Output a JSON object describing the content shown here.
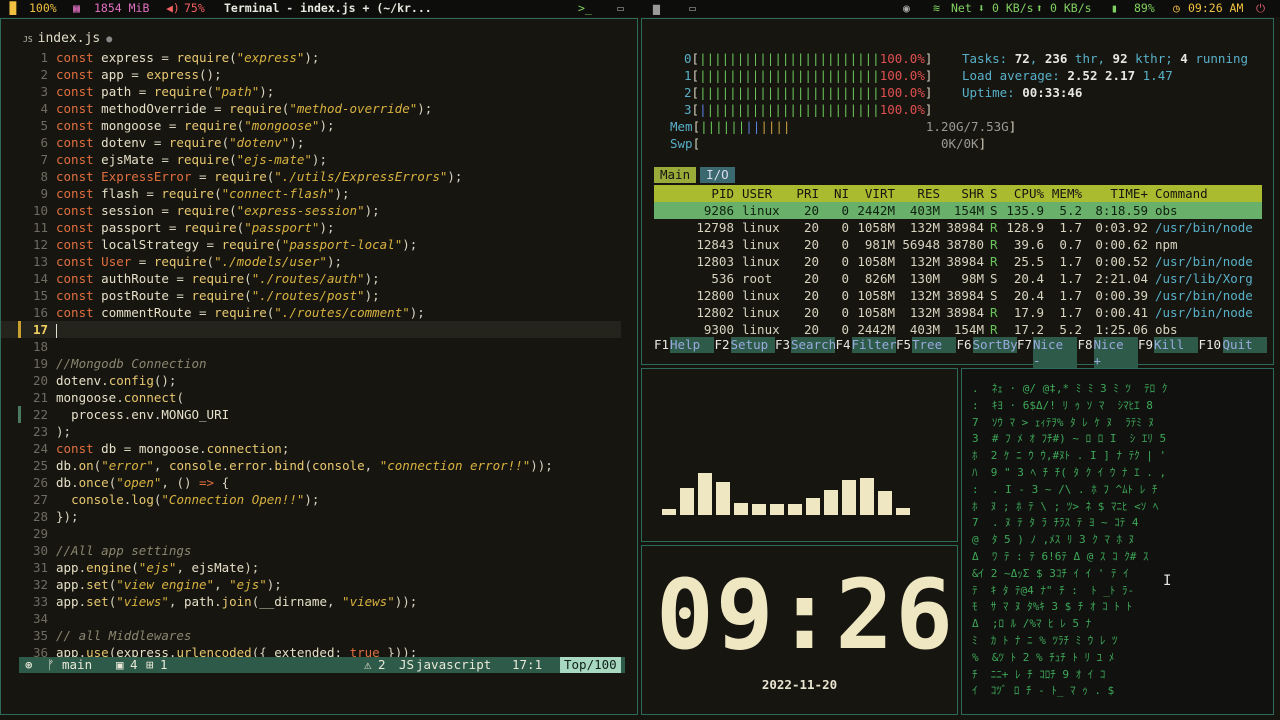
{
  "topbar": {
    "cpu_icon": "cpu-chart-icon",
    "cpu": "100%",
    "mem_icon": "memory-icon",
    "mem": "1854 MiB",
    "vol_icon": "volume-icon",
    "vol": "75%",
    "title": "Terminal - index.js + (~/kr...",
    "ws_icons": [
      "terminal-icon",
      "monitor-icon",
      "folder-icon",
      "display-icon"
    ],
    "net_label": "Net",
    "net_down": "0 KB/s",
    "net_up": "0 KB/s",
    "battery": "89%",
    "time": "09:26 AM"
  },
  "editor": {
    "filename": "index.js",
    "status": {
      "mode_icon": "vim-icon",
      "branch": "main",
      "changes": "4",
      "added": "1",
      "warnings": "2",
      "lang": "javascript",
      "pos": "17:1",
      "pct": "Top/100"
    }
  },
  "htop": {
    "cpus": [
      {
        "id": "0",
        "pct": "100.0%"
      },
      {
        "id": "1",
        "pct": "100.0%"
      },
      {
        "id": "2",
        "pct": "100.0%"
      },
      {
        "id": "3",
        "pct": "100.0%"
      }
    ],
    "mem_label": "Mem",
    "mem_val": "1.20G/7.53G",
    "swp_label": "Swp",
    "swp_val": "0K/0K",
    "tasks_label": "Tasks:",
    "tasks": "72",
    "thr": "236",
    "kthr": "92",
    "running": "4",
    "load_label": "Load average:",
    "load1": "2.52",
    "load5": "2.17",
    "load15": "1.47",
    "uptime_label": "Uptime:",
    "uptime": "00:33:46",
    "tabs": [
      "Main",
      "I/O"
    ],
    "headers": [
      "PID",
      "USER",
      "PRI",
      "NI",
      "VIRT",
      "RES",
      "SHR",
      "S",
      "CPU%",
      "MEM%",
      "TIME+",
      "Command"
    ],
    "procs": [
      {
        "pid": "9286",
        "user": "linux",
        "pri": "20",
        "ni": "0",
        "virt": "2442M",
        "res": "403M",
        "shr": "154M",
        "s": "S",
        "cpu": "135.9",
        "mem": "5.2",
        "time": "8:18.59",
        "cmd": "obs"
      },
      {
        "pid": "12798",
        "user": "linux",
        "pri": "20",
        "ni": "0",
        "virt": "1058M",
        "res": "132M",
        "shr": "38984",
        "s": "R",
        "cpu": "128.9",
        "mem": "1.7",
        "time": "0:03.92",
        "cmd": "/usr/bin/node"
      },
      {
        "pid": "12843",
        "user": "linux",
        "pri": "20",
        "ni": "0",
        "virt": "981M",
        "res": "56948",
        "shr": "38780",
        "s": "R",
        "cpu": "39.6",
        "mem": "0.7",
        "time": "0:00.62",
        "cmd": "npm"
      },
      {
        "pid": "12803",
        "user": "linux",
        "pri": "20",
        "ni": "0",
        "virt": "1058M",
        "res": "132M",
        "shr": "38984",
        "s": "R",
        "cpu": "25.5",
        "mem": "1.7",
        "time": "0:00.52",
        "cmd": "/usr/bin/node"
      },
      {
        "pid": "536",
        "user": "root",
        "pri": "20",
        "ni": "0",
        "virt": "826M",
        "res": "130M",
        "shr": "98M",
        "s": "S",
        "cpu": "20.4",
        "mem": "1.7",
        "time": "2:21.04",
        "cmd": "/usr/lib/Xorg"
      },
      {
        "pid": "12800",
        "user": "linux",
        "pri": "20",
        "ni": "0",
        "virt": "1058M",
        "res": "132M",
        "shr": "38984",
        "s": "S",
        "cpu": "20.4",
        "mem": "1.7",
        "time": "0:00.39",
        "cmd": "/usr/bin/node"
      },
      {
        "pid": "12802",
        "user": "linux",
        "pri": "20",
        "ni": "0",
        "virt": "1058M",
        "res": "132M",
        "shr": "38984",
        "s": "R",
        "cpu": "17.9",
        "mem": "1.7",
        "time": "0:00.41",
        "cmd": "/usr/bin/node"
      },
      {
        "pid": "9300",
        "user": "linux",
        "pri": "20",
        "ni": "0",
        "virt": "2442M",
        "res": "403M",
        "shr": "154M",
        "s": "R",
        "cpu": "17.2",
        "mem": "5.2",
        "time": "1:25.06",
        "cmd": "obs"
      }
    ],
    "fkeys": [
      {
        "k": "F1",
        "f": "Help"
      },
      {
        "k": "F2",
        "f": "Setup"
      },
      {
        "k": "F3",
        "f": "Search"
      },
      {
        "k": "F4",
        "f": "Filter"
      },
      {
        "k": "F5",
        "f": "Tree"
      },
      {
        "k": "F6",
        "f": "SortBy"
      },
      {
        "k": "F7",
        "f": "Nice -"
      },
      {
        "k": "F8",
        "f": "Nice +"
      },
      {
        "k": "F9",
        "f": "Kill"
      },
      {
        "k": "F10",
        "f": "Quit"
      }
    ]
  },
  "visualizer": {
    "levels": [
      0.1,
      0.45,
      0.7,
      0.55,
      0.2,
      0.18,
      0.18,
      0.18,
      0.28,
      0.42,
      0.58,
      0.62,
      0.4,
      0.12
    ]
  },
  "clock": {
    "time": "09:26",
    "date": "2022-11-20"
  },
  "matrix": {
    "text": ".  ﾈｪ · @/ @‡,* ﾐ ﾐ 3 ﾐ ﾂ  ﾃﾛ ｸ\n:  ｷﾖ · 6$Δ/! ﾘ ｩ ｿ ﾏ  ｼﾏﾋｴ 8\n7  ｿｳ ﾏ > ｪｨﾃｦ% ﾀ ﾚ ｹ ﾇ  ﾗﾃﾐ ﾇ\n3  # ﾌ ﾒ ｵ ﾌﾁ#) ~ ﾛ ﾛ I  ｼ ｴﾘ 5\nﾎ  2 ｹ ﾆ ｳ ｳ,#ﾇﾄ . I ] ﾅ ﾃｸ | '\nﾊ  9 \" 3 ﾍ ﾁ ﾁ( ﾀ ｸ ｲ ｳ ﾅ ｴ . ,\n:  . I - 3 ~ /\\ . ﾎ ﾌ ^ﾑﾄ ﾚ ﾁ\nﾎ  ﾇ ; ﾎ ﾃ \\ ; ﾂ> ﾈ $ ﾏﾆﾋ <ｿ ﾍ\n7  . ﾇ ﾃ ﾀ ﾗ ﾁﾗｽ ﾃ ﾖ ~ ｺﾃ 4\n@  ﾀ 5 ) ﾉ ,ﾒｽ ﾘ 3 ｸ ﾏ ﾎ ﾇ\nΔ  ﾜ ﾃ : ﾃ 6!6ﾃ Δ @ ｽ ｺ ｸ# ｽ\n&ｲ 2 ~ΔｯΣ $ 3ｺﾁ ｲ ｲ ' ﾃ ｲ\nﾃ  ｷ ﾀ ﾃ@4 ﾅ\" ﾁ :  ﾄ _ﾄ ﾗ-\nﾓ  ｻ ﾏ ﾇ ﾀ%ｷ 3 $ ﾁ ｵ ｺ ﾄ ﾄ\nΔ  ;ﾛ ﾙ /%ﾏ ﾋ ﾚ 5 ﾅ\nﾐ  ｶ ﾄ ﾅ ﾆ % ﾂﾗﾁ ﾐ ｳ ﾚ ﾂ\n%  &ﾂ ﾄ 2 % ﾁｭﾁ ﾄ ﾘ ﾕ ﾒ\nﾁ  ﾆﾆ+ ﾚ ﾁ ｺﾛﾁ 9 ｵ ｲ ｺ\nｲ  ｺﾂﾞ ﾛ ﾁ - ﾄ_ ﾏ ｩ . $"
  }
}
